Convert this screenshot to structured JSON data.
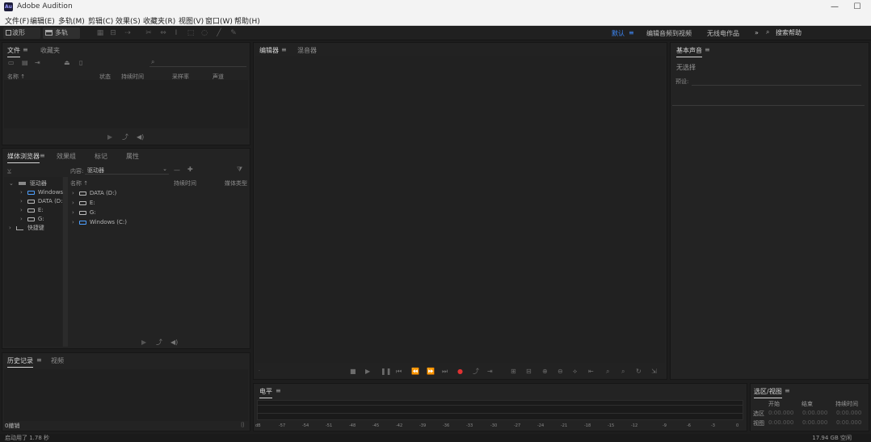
{
  "window": {
    "title": "Adobe Audition",
    "app_icon": "Au",
    "controls": {
      "minimize": "—",
      "maximize": "☐",
      "close": "✕"
    }
  },
  "menubar": [
    "文件(F)",
    "编辑(E)",
    "多轨(M)",
    "剪辑(C)",
    "效果(S)",
    "收藏夹(R)",
    "视图(V)",
    "窗口(W)",
    "帮助(H)"
  ],
  "toolbar": {
    "waveform_label": "波形",
    "multitrack_label": "多轨",
    "tool_icons": [
      "spectral-frequency-icon",
      "spectral-pitch-icon",
      "move-tool-icon",
      "razor-tool-icon",
      "slip-tool-icon",
      "time-selection-icon",
      "marquee-icon",
      "lasso-icon",
      "brush-icon",
      "spot-healing-icon"
    ],
    "workspaces": {
      "active": "默认",
      "edit_audio_video": "编辑音频到视频",
      "radio": "无线电作品",
      "more": "»"
    },
    "search_label": "搜索帮助"
  },
  "files_panel": {
    "tabs": [
      "文件",
      "收藏夹"
    ],
    "search_placeholder": "",
    "columns": [
      "名称 ↑",
      "状态",
      "持续时间",
      "采样率",
      "声道"
    ]
  },
  "media_browser": {
    "tabs": [
      "媒体浏览器",
      "效果组",
      "标记",
      "属性"
    ],
    "contents_label": "内容:",
    "contents_value": "驱动器",
    "tree": [
      "驱动器",
      "Windows",
      "DATA (D:)",
      "E:",
      "G:",
      "快捷键"
    ],
    "list_header": [
      "名称 ↑",
      "持续时间",
      "媒体类型"
    ],
    "list": [
      "DATA (D:)",
      "E:",
      "G:",
      "Windows (C:)"
    ]
  },
  "history_panel": {
    "tabs": [
      "历史记录",
      "视频"
    ],
    "undo_label": "0撤销"
  },
  "editor": {
    "tabs": [
      "编辑器",
      "混音器"
    ]
  },
  "transport_icons": [
    "stop-icon",
    "play-icon",
    "pause-icon",
    "go-to-start-icon",
    "rewind-icon",
    "fast-forward-icon",
    "go-to-end-icon",
    "record-icon",
    "loop-icon",
    "skip-icon"
  ],
  "zoom_icons": [
    "zoom-in-amp-icon",
    "zoom-out-amp-icon",
    "zoom-in-time-icon",
    "zoom-out-time-icon",
    "zoom-selection-icon",
    "zoom-full-icon",
    "zoom-in-point-icon",
    "zoom-out-point-icon",
    "zoom-reset-icon",
    "zoom-fit-icon"
  ],
  "levels": {
    "title": "电平",
    "ticks": [
      "dB",
      "-57",
      "-54",
      "-51",
      "-48",
      "-45",
      "-42",
      "-39",
      "-36",
      "-33",
      "-30",
      "-27",
      "-24",
      "-21",
      "-18",
      "-15",
      "-12",
      "-9",
      "-6",
      "-3",
      "0"
    ]
  },
  "essential_sound": {
    "title": "基本声音",
    "no_selection": "无选择",
    "preset_label": "预设:"
  },
  "selection_view": {
    "title": "选区/视图",
    "headers": [
      "开始",
      "结束",
      "持续时间"
    ],
    "rows": [
      {
        "label": "选区",
        "start": "0:00.000",
        "end": "0:00.000",
        "duration": "0:00.000"
      },
      {
        "label": "视图",
        "start": "0:00.000",
        "end": "0:00.000",
        "duration": "0:00.000"
      }
    ]
  },
  "status": {
    "left": "启动用了 1.78 秒",
    "right": "17.94 GB 空闲"
  },
  "colors": {
    "accent": "#3f8cff",
    "record": "#e03232",
    "panel_bg": "#232323",
    "app_bg": "#1d1d1d"
  }
}
